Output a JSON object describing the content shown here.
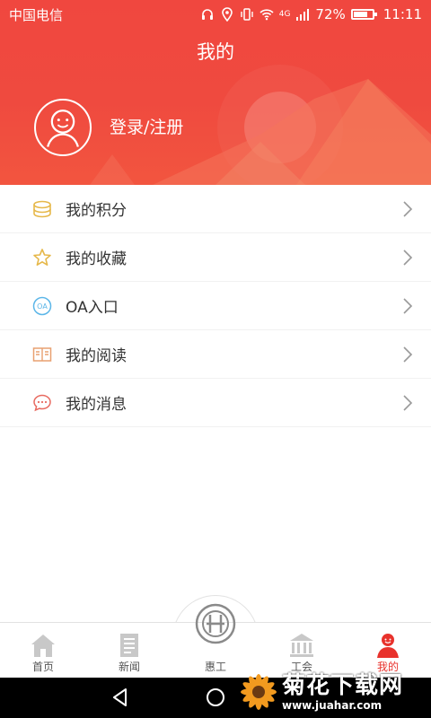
{
  "status_bar": {
    "carrier": "中国电信",
    "network": "4G",
    "battery": "72%",
    "time": "11:11"
  },
  "header": {
    "title": "我的",
    "login_label": "登录/注册"
  },
  "menu": {
    "items": [
      {
        "label": "我的积分",
        "icon": "coins-icon",
        "color": "#e6b84a"
      },
      {
        "label": "我的收藏",
        "icon": "star-icon",
        "color": "#e6b84a"
      },
      {
        "label": "OA入口",
        "icon": "oa-icon",
        "color": "#5bb6e8"
      },
      {
        "label": "我的阅读",
        "icon": "book-icon",
        "color": "#e8a070"
      },
      {
        "label": "我的消息",
        "icon": "message-icon",
        "color": "#e86a60"
      }
    ]
  },
  "tabbar": {
    "tabs": [
      {
        "label": "首页",
        "icon": "home-icon"
      },
      {
        "label": "新闻",
        "icon": "news-icon"
      },
      {
        "label": "惠工",
        "icon": "union-logo-icon"
      },
      {
        "label": "工会",
        "icon": "building-icon"
      },
      {
        "label": "我的",
        "icon": "person-icon"
      }
    ],
    "active_color": "#e8322c"
  },
  "watermark": {
    "name": "菊花下载网",
    "url": "www.juahar.com"
  },
  "colors": {
    "header": "#ef4a3f",
    "accent": "#e8322c"
  }
}
